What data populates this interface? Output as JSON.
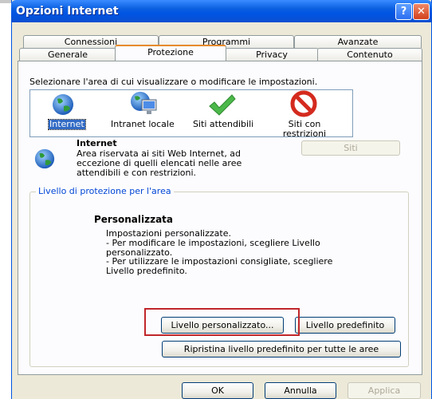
{
  "window": {
    "title": "Opzioni Internet"
  },
  "title_buttons": {
    "help": "?",
    "close": "✕"
  },
  "tabs_row1": [
    "Connessioni",
    "Programmi",
    "Avanzate"
  ],
  "tabs_row2": [
    "Generale",
    "Protezione",
    "Privacy",
    "Contenuto"
  ],
  "zones": {
    "heading": "Selezionare l'area di cui visualizzare o modificare le impostazioni.",
    "items": [
      {
        "label": "Internet",
        "icon": "globe-icon"
      },
      {
        "label": "Intranet locale",
        "icon": "computer-globe-icon"
      },
      {
        "label": "Siti attendibili",
        "icon": "checkmark-icon"
      },
      {
        "label": "Siti con restrizioni",
        "icon": "no-entry-icon"
      }
    ]
  },
  "selected_zone": {
    "name": "Internet",
    "description": "Area riservata ai siti Web Internet, ad eccezione di quelli elencati nelle aree attendibili e con restrizioni.",
    "sites_button": "Siti"
  },
  "protection": {
    "group_title": "Livello di protezione per l'area",
    "level_name": "Personalizzata",
    "lines": [
      "Impostazioni personalizzate.",
      "- Per modificare le impostazioni, scegliere Livello",
      "personalizzato.",
      "- Per utilizzare le impostazioni consigliate, scegliere",
      "Livello predefinito."
    ],
    "custom_button": "Livello personalizzato...",
    "default_button": "Livello predefinito",
    "reset_all_button": "Ripristina livello predefinito per tutte le aree"
  },
  "footer": {
    "ok": "OK",
    "cancel": "Annulla",
    "apply": "Applica"
  },
  "colors": {
    "title_bar": "#0054e3",
    "selection": "#316ac5",
    "highlight_box": "#c0262a",
    "active_tab": "#e68b2c"
  }
}
